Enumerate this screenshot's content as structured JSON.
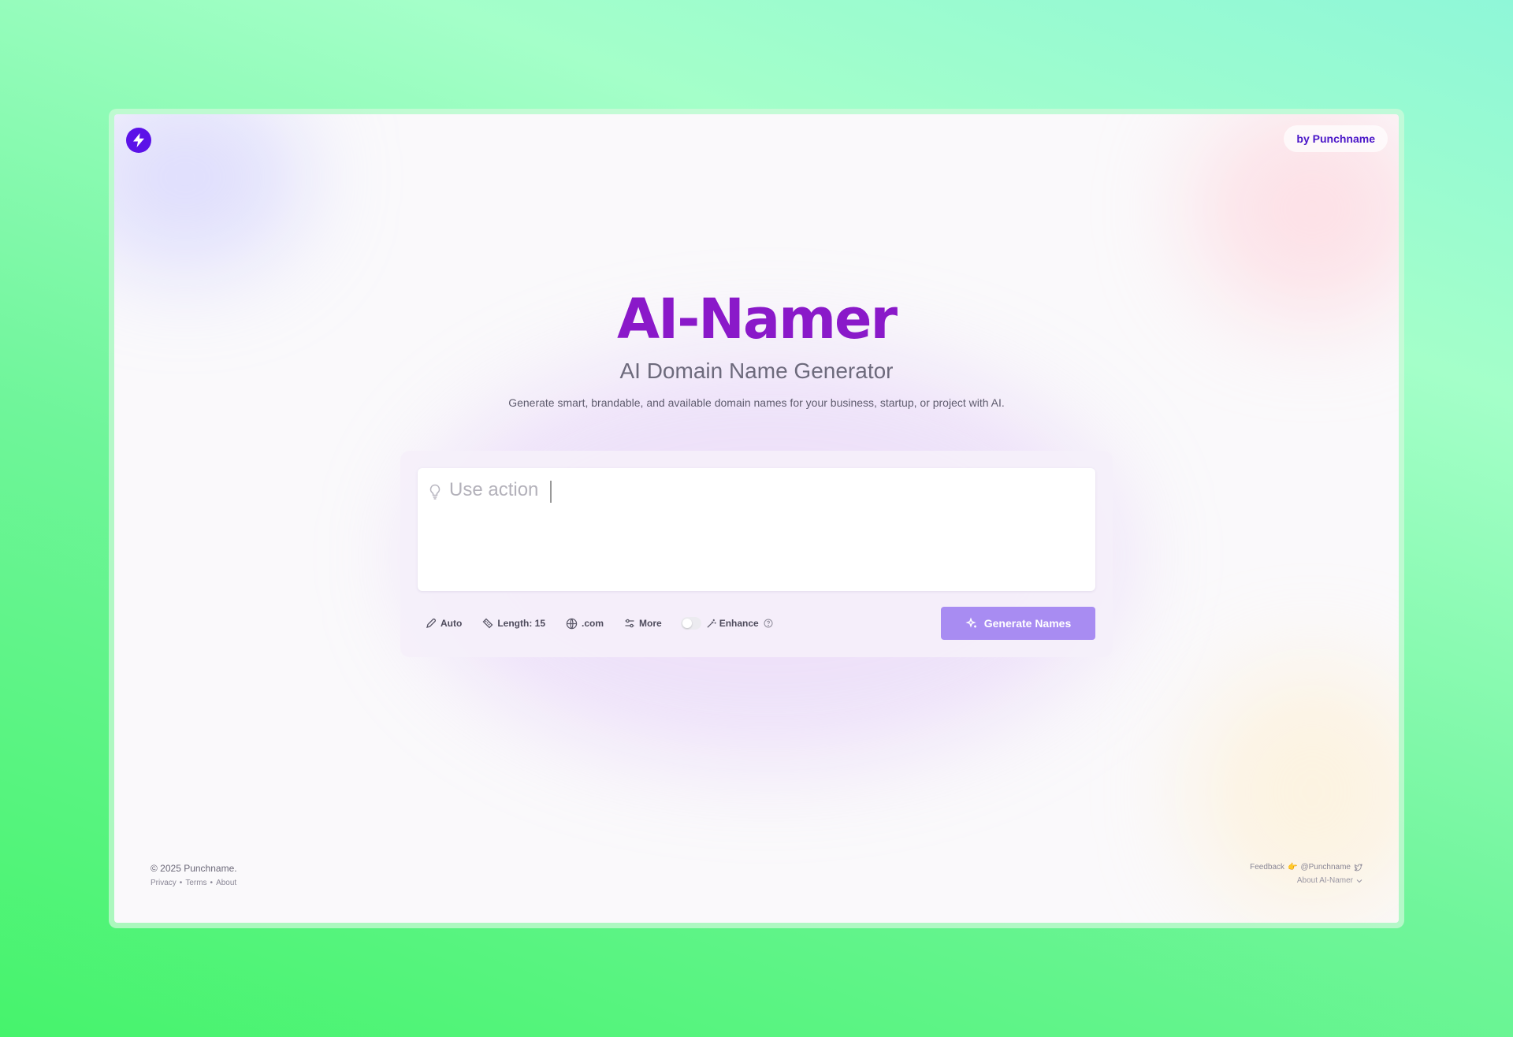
{
  "header": {
    "logo_icon": "lightning-bolt-icon",
    "by_label": "by Punchname"
  },
  "hero": {
    "brand": "AI-Namer",
    "subtitle": "AI Domain Name Generator",
    "tagline": "Generate smart, brandable, and available domain names for your business, startup, or project with AI."
  },
  "prompt": {
    "placeholder": "Use action",
    "value": ""
  },
  "toolbar": {
    "style_label": "Auto",
    "length_label": "Length: 15",
    "tld_label": ".com",
    "more_label": "More",
    "enhance_label": "Enhance",
    "enhance_on": false,
    "generate_label": "Generate Names"
  },
  "footer": {
    "copyright": "© 2025 Punchname.",
    "links": [
      "Privacy",
      "Terms",
      "About"
    ],
    "feedback_label": "Feedback",
    "feedback_emoji": "👉",
    "handle": "@Punchname",
    "about_label": "About AI-Namer"
  },
  "colors": {
    "accent": "#5b12e8",
    "brand": "#8a19c9",
    "button": "#a88cf2"
  }
}
